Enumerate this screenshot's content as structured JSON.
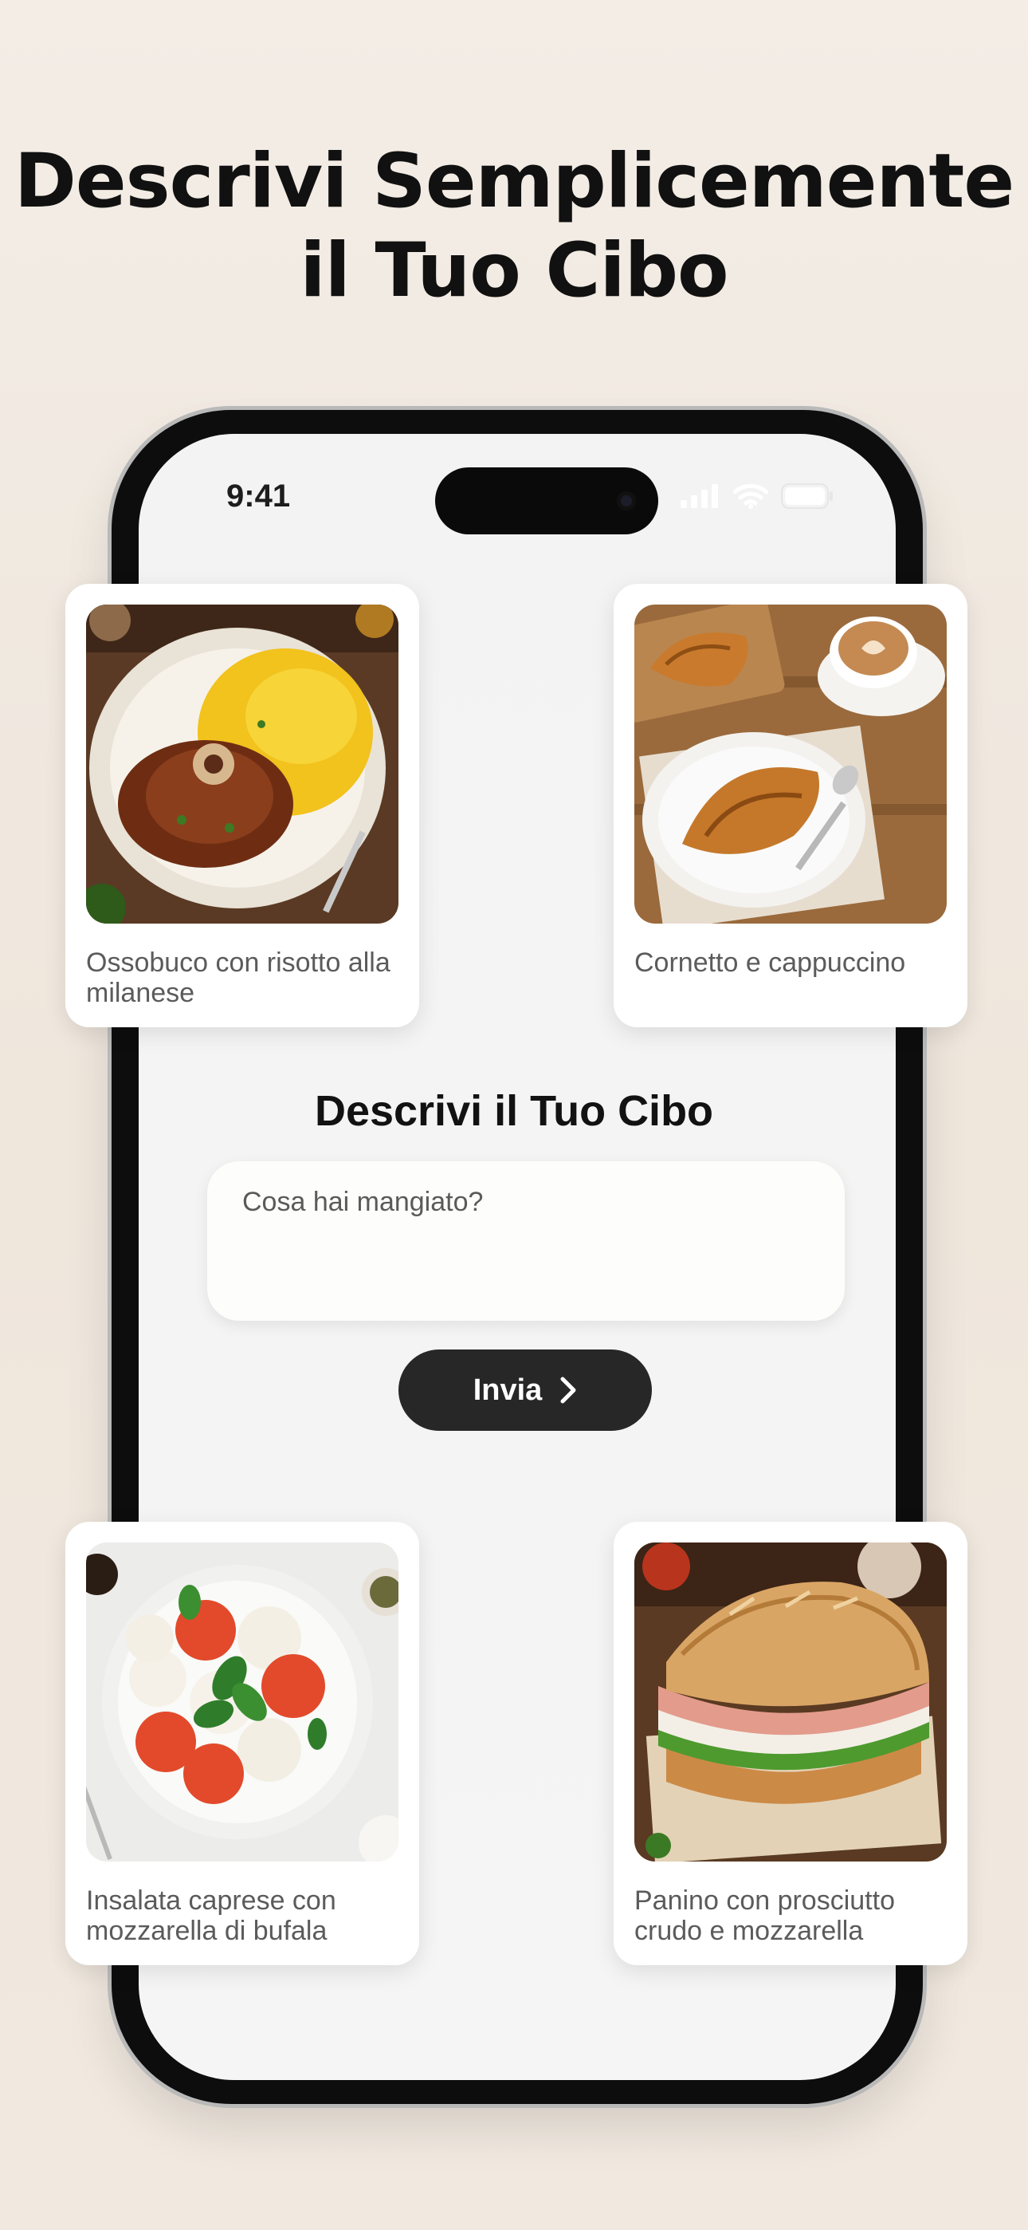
{
  "headline": {
    "line1": "Descrivi Semplicemente",
    "line2": "il Tuo Cibo"
  },
  "status_bar": {
    "time": "9:41",
    "icons": [
      "signal-icon",
      "wifi-icon",
      "battery-icon"
    ]
  },
  "cards": [
    {
      "caption": "Ossobuco con risotto alla milanese",
      "photo": "ossobuco-photo"
    },
    {
      "caption": "Cornetto e cappuccino",
      "photo": "cornetto-photo"
    },
    {
      "caption": "Insalata caprese con mozzarella di bufala",
      "photo": "caprese-photo"
    },
    {
      "caption": "Panino con prosciutto crudo e mozzarella",
      "photo": "panino-photo"
    }
  ],
  "form": {
    "title": "Descrivi il Tuo Cibo",
    "input_placeholder": "Cosa hai mangiato?",
    "submit_label": "Invia",
    "submit_icon": "chevron-right-icon"
  },
  "colors": {
    "background": "#f2ebe3",
    "button": "#272727",
    "headline": "#111111"
  }
}
